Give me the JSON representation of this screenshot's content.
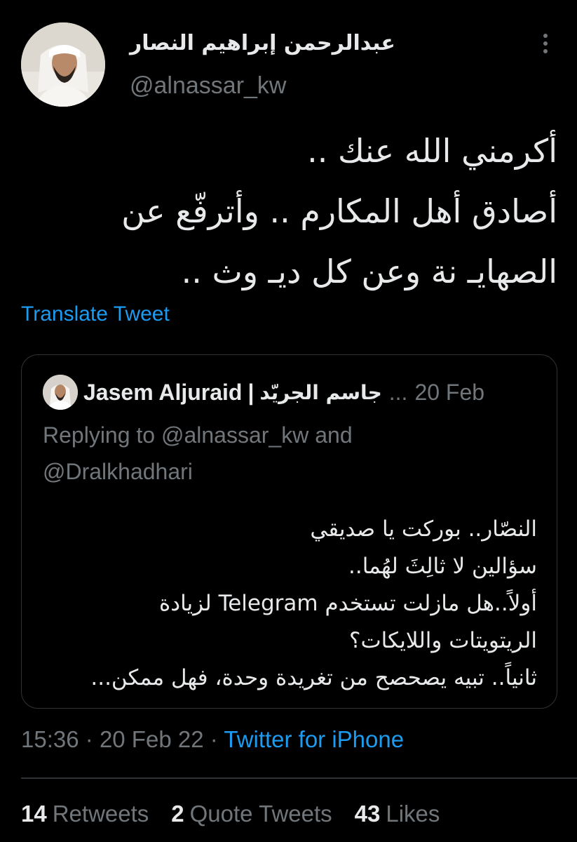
{
  "author": {
    "display_name": "عبدالرحمن إبراهيم النصار",
    "handle": "@alnassar_kw"
  },
  "tweet": {
    "lines": [
      "أكرمني الله عنك  ..",
      "أصادق أهل المكارم .. وأترفّع عن",
      "الصهايـ نة وعن كل ديـ وث .."
    ],
    "translate_label": "Translate Tweet"
  },
  "quoted": {
    "name": "Jasem Aljuraid",
    "separator": "|",
    "name_ar": "جاسم الجريّد",
    "dots": "...",
    "date": "20 Feb",
    "replying_line1": "Replying to @alnassar_kw and",
    "replying_line2": "@Dralkhadhari",
    "lines": [
      "النصّار.. بوركت يا صديقي",
      "سؤالين لا ثالِثَ لهُما..",
      "أولاً..هل مازلت تستخدم Telegram لزيادة",
      "الريتويتات واللايكات؟",
      "ثانياً.. تبيه يصحصح من تغريدة وحدة، فهل ممكن..."
    ]
  },
  "meta": {
    "time": "15:36",
    "date": "20 Feb 22",
    "dot": "·",
    "source": "Twitter for iPhone"
  },
  "stats": {
    "retweets_count": "14",
    "retweets_label": "Retweets",
    "quotes_count": "2",
    "quotes_label": "Quote Tweets",
    "likes_count": "43",
    "likes_label": "Likes"
  },
  "icons": {
    "more": "more-vertical-icon",
    "avatar": "profile-photo",
    "quoted_avatar": "profile-photo"
  },
  "colors": {
    "background": "#000000",
    "text": "#e7e9ea",
    "secondary": "#71767b",
    "accent": "#1d9bf0",
    "border": "#2f3336"
  }
}
